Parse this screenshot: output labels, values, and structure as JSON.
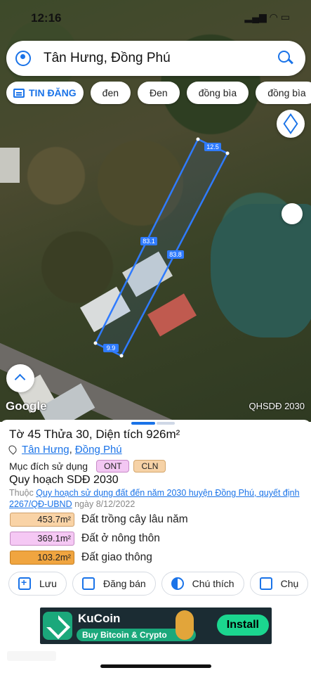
{
  "status": {
    "time": "12:16"
  },
  "search": {
    "query": "Tân Hưng, Đồng Phú"
  },
  "chips": [
    {
      "label": "TIN ĐĂNG"
    },
    {
      "label": "đen"
    },
    {
      "label": "Đen"
    },
    {
      "label": "đồng bìa"
    },
    {
      "label": "đồng bìa"
    }
  ],
  "map": {
    "attribution": "Google",
    "layer_label": "QHSDĐ 2030",
    "parcel_edges": [
      "12.5",
      "83.1",
      "83.8",
      "9.9"
    ]
  },
  "parcel": {
    "title": "Tờ 45 Thửa 30, Diện tích 926m²",
    "commune": "Tân Hưng",
    "separator": ",",
    "district": "Đồng Phú",
    "purpose_label": "Mục đích sử dụng",
    "purpose_tags": [
      "ONT",
      "CLN"
    ],
    "plan_title": "Quy hoạch SDĐ 2030",
    "plan_prefix": "Thuộc",
    "plan_link": "Quy hoạch sử dụng đất đến năm 2030 huyện Đồng Phú, quyết định 2267/QĐ-UBND",
    "plan_date": "ngày 8/12/2022",
    "allocations": [
      {
        "area": "453.7m²",
        "label": "Đất trồng cây lâu năm",
        "color": "#f9d3a6"
      },
      {
        "area": "369.1m²",
        "label": "Đất ở nông thôn",
        "color": "#f5c8f4"
      },
      {
        "area": "103.2m²",
        "label": "Đất giao thông",
        "color": "#f0a540"
      }
    ]
  },
  "actions": [
    {
      "label": "Lưu",
      "icon": "bookmark-plus-icon"
    },
    {
      "label": "Đăng bán",
      "icon": "listing-icon"
    },
    {
      "label": "Chú thích",
      "icon": "legend-icon"
    },
    {
      "label": "Chụ",
      "icon": "camera-icon"
    }
  ],
  "ad": {
    "brand": "KuCoin",
    "tagline": "Buy Bitcoin & Crypto",
    "cta": "Install"
  },
  "colors": {
    "accent": "#1a73e8",
    "parcel_line": "#2f7bff"
  }
}
